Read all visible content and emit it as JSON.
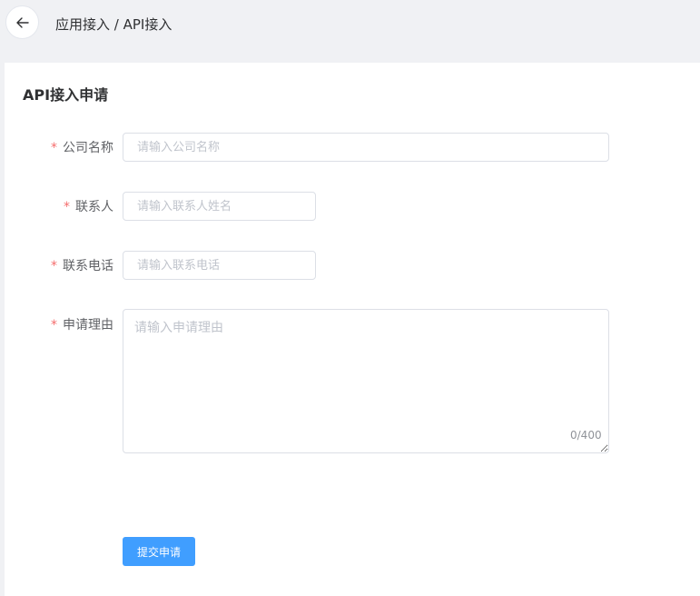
{
  "header": {
    "breadcrumb": "应用接入 / API接入"
  },
  "form": {
    "title": "API接入申请",
    "required_mark": "*",
    "company": {
      "label": "公司名称",
      "placeholder": "请输入公司名称",
      "value": ""
    },
    "contact": {
      "label": "联系人",
      "placeholder": "请输入联系人姓名",
      "value": ""
    },
    "phone": {
      "label": "联系电话",
      "placeholder": "请输入联系电话",
      "value": ""
    },
    "reason": {
      "label": "申请理由",
      "placeholder": "请输入申请理由",
      "value": "",
      "counter": "0/400"
    },
    "submit_label": "提交申请"
  },
  "icons": {
    "back": "arrow-left-icon"
  },
  "colors": {
    "primary": "#409eff",
    "required": "#f56c6c"
  }
}
